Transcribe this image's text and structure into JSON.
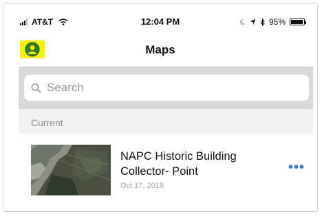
{
  "status_bar": {
    "carrier": "AT&T",
    "time": "12:04 PM",
    "battery": "95%",
    "battery_level": 0.95
  },
  "nav": {
    "title": "Maps",
    "profile_icon": "person-circle-icon"
  },
  "search": {
    "placeholder": "Search",
    "value": ""
  },
  "section": {
    "header": "Current"
  },
  "maps": [
    {
      "title_line1": "NAPC Historic Building",
      "title_line2": "Collector- Point",
      "date": "Oct 17, 2018"
    }
  ],
  "colors": {
    "accent": "#3b78d8",
    "highlight": "#f2f200",
    "search_bg": "#d9d9dc",
    "section_bg": "#f1f1f3"
  }
}
